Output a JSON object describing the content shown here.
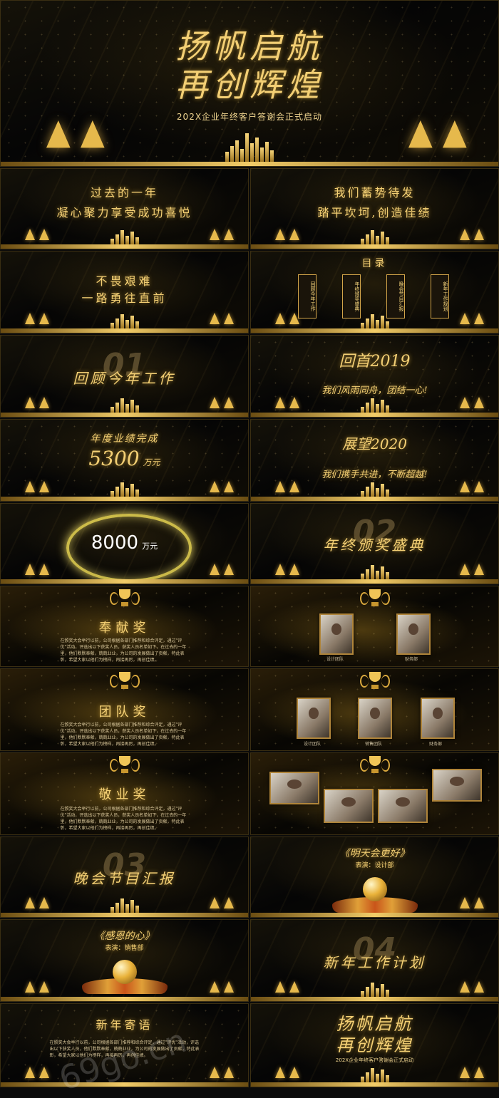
{
  "cover": {
    "title_line1": "扬帆启航",
    "title_line2": "再创辉煌",
    "subtitle": "202X企业年终客户答谢会正式启动"
  },
  "slides": {
    "s2": {
      "line1": "过去的一年",
      "line2": "凝心聚力享受成功喜悦"
    },
    "s3": {
      "line1": "我们蓄势待发",
      "line2": "踏平坎坷,创造佳绩"
    },
    "s4": {
      "line1": "不畏艰难",
      "line2": "一路勇往直前"
    },
    "s5": {
      "title": "目录",
      "items": [
        "回顾今年工作",
        "年终颁奖盛典",
        "晚会节目汇报",
        "新年工作规划"
      ]
    },
    "s6": {
      "num": "01",
      "title": "回顾今年工作"
    },
    "s7": {
      "title": "回首2019",
      "sub": "我们风雨同舟，团结一心!"
    },
    "s8": {
      "line1": "年度业绩完成",
      "value": "5300",
      "unit": "万元"
    },
    "s9": {
      "title": "展望2020",
      "sub": "我们携手共进，不断超越!"
    },
    "s10": {
      "value": "8000",
      "unit": "万元"
    },
    "s11": {
      "num": "02",
      "title": "年终颁奖盛典"
    },
    "s12": {
      "title": "奉献奖",
      "para": "在颁奖大会举行以前，公司根据各部门推荐和综合评定，通过\"评优\"活动，评选出以下获奖人员，获奖人员名单如下，在过去的一年里，他们默默奉献，兢兢业业，为公司的发展做出了贡献，特此表彰，希望大家以他们为榜样，再接再厉，再创佳绩。"
    },
    "s13": {
      "captions": [
        "设计团队",
        "财务部"
      ]
    },
    "s14": {
      "title": "团队奖",
      "para": "在颁奖大会举行以前，公司根据各部门推荐和综合评定，通过\"评优\"活动，评选出以下获奖人员，获奖人员名单如下，在过去的一年里，他们默默奉献，兢兢业业，为公司的发展做出了贡献，特此表彰，希望大家以他们为榜样，再接再厉，再创佳绩。"
    },
    "s15": {
      "captions": [
        "设计团队",
        "销售团队",
        "财务部"
      ]
    },
    "s16": {
      "title": "敬业奖",
      "para": "在颁奖大会举行以前，公司根据各部门推荐和综合评定，通过\"评优\"活动，评选出以下获奖人员，获奖人员名单如下，在过去的一年里，他们默默奉献，兢兢业业，为公司的发展做出了贡献，特此表彰，希望大家以他们为榜样，再接再厉，再创佳绩。"
    },
    "s18": {
      "num": "03",
      "title": "晚会节目汇报"
    },
    "s19": {
      "title": "《明天会更好》",
      "performer": "表演：设计部"
    },
    "s20": {
      "title": "《感恩的心》",
      "performer": "表演：销售部"
    },
    "s21": {
      "num": "04",
      "title": "新年工作计划"
    },
    "s22": {
      "title": "新年寄语",
      "para": "在颁奖大会举行以前，公司根据各部门推荐和综合评定，通过\"评优\"活动，评选出以下获奖人员，他们默默奉献，兢兢业业，为公司的发展做出了贡献，特此表彰，希望大家以他们为榜样，再接再厉，再创佳绩。"
    },
    "s23": {
      "title_line1": "扬帆启航",
      "title_line2": "再创辉煌",
      "subtitle": "202X企业年终客户答谢会正式启动"
    }
  },
  "watermark": "69go.cn"
}
